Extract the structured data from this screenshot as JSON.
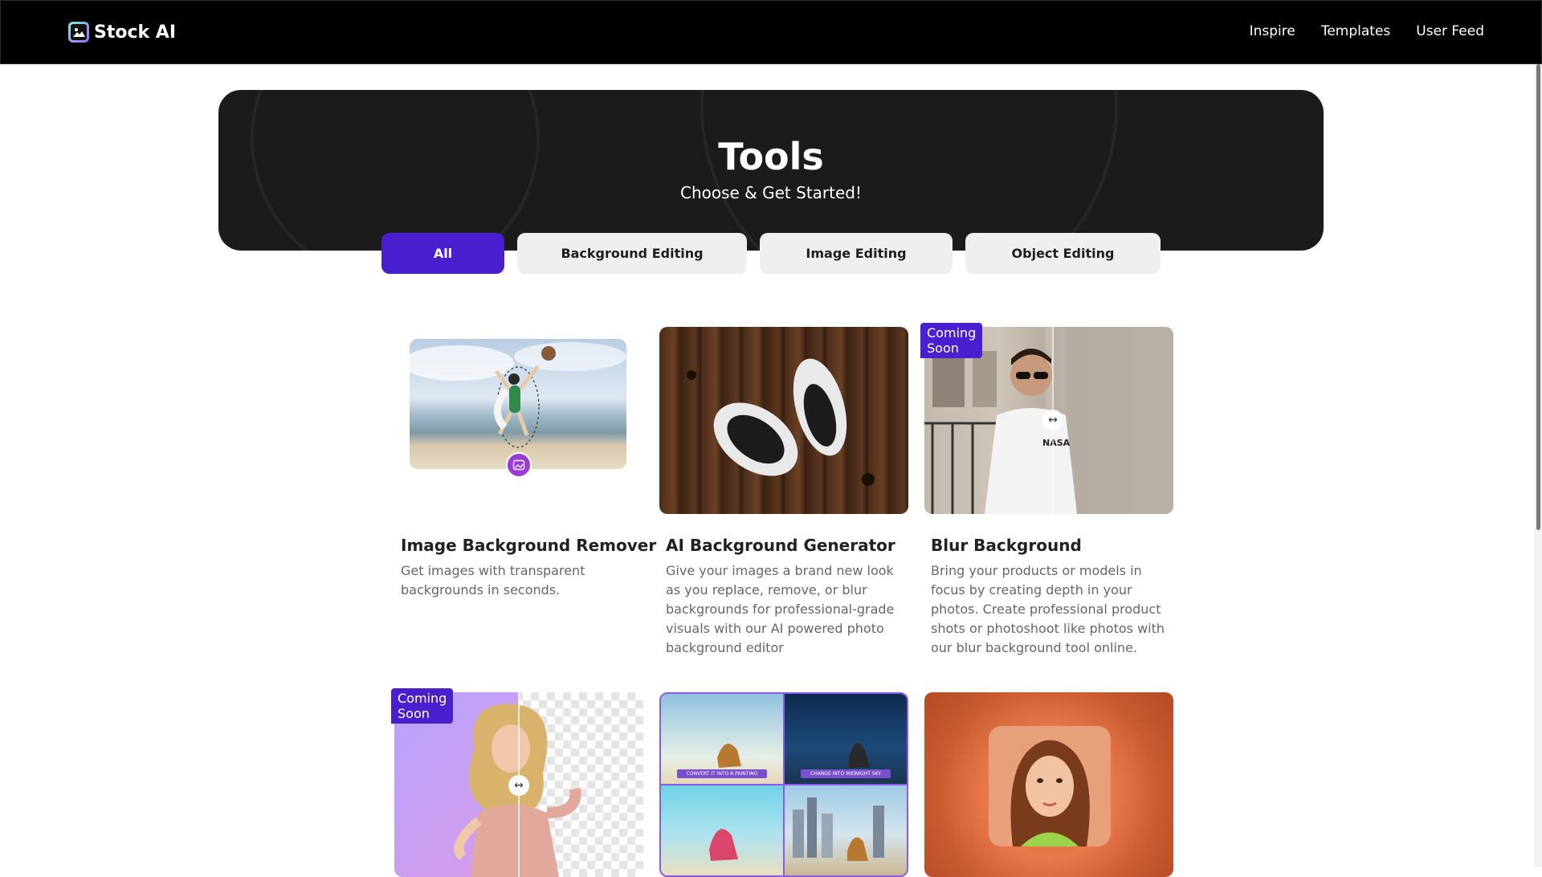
{
  "header": {
    "brand": "Stock AI",
    "nav": [
      "Inspire",
      "Templates",
      "User Feed"
    ]
  },
  "hero": {
    "title": "Tools",
    "subtitle": "Choose & Get Started!"
  },
  "tabs": [
    "All",
    "Background Editing",
    "Image Editing",
    "Object Editing"
  ],
  "active_tab": "All",
  "cards": [
    {
      "title": "Image Background Remover",
      "desc": "Get images with transparent backgrounds in seconds."
    },
    {
      "title": "AI Background Generator",
      "desc": "Give your images a brand new look as you replace, remove, or blur backgrounds for professional-grade visuals with our AI powered photo background editor"
    },
    {
      "title": "Blur Background",
      "badge": "Coming Soon",
      "desc": "Bring your products or models in focus by creating depth in your photos. Create professional product shots or photoshoot like photos with our blur background tool online."
    },
    {
      "badge": "Coming Soon"
    }
  ],
  "panel_captions": [
    "CONVERT IT INTO A PAINTING",
    "CHANGE INTO MIDNIGHT SKY"
  ],
  "colors": {
    "accent": "#4a1fd0",
    "header_bg": "#000000",
    "hero_bg": "#1b1b1c"
  }
}
